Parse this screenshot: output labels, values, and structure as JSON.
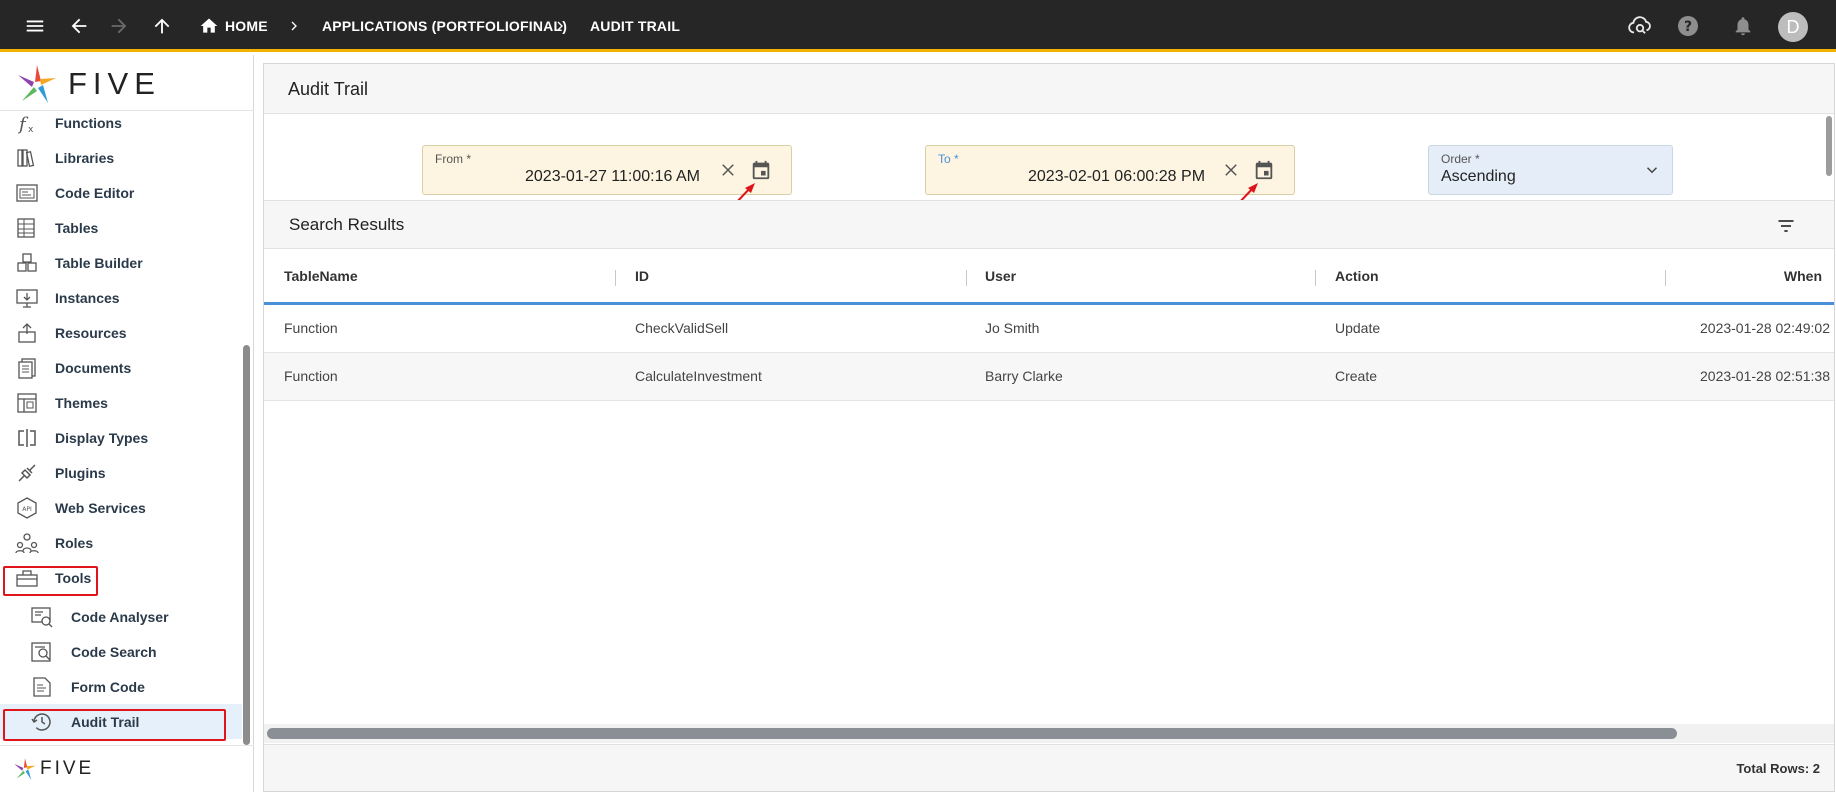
{
  "topbar": {
    "breadcrumbs": [
      "HOME",
      "APPLICATIONS (PORTFOLIOFINAL)",
      "AUDIT TRAIL"
    ],
    "avatar_initial": "D"
  },
  "sidebar": {
    "brand": "FIVE",
    "items": [
      {
        "label": "Functions",
        "icon": "function-icon"
      },
      {
        "label": "Libraries",
        "icon": "libraries-icon"
      },
      {
        "label": "Code Editor",
        "icon": "code-editor-icon"
      },
      {
        "label": "Tables",
        "icon": "tables-icon"
      },
      {
        "label": "Table Builder",
        "icon": "table-builder-icon"
      },
      {
        "label": "Instances",
        "icon": "instances-icon"
      },
      {
        "label": "Resources",
        "icon": "resources-icon"
      },
      {
        "label": "Documents",
        "icon": "documents-icon"
      },
      {
        "label": "Themes",
        "icon": "themes-icon"
      },
      {
        "label": "Display Types",
        "icon": "display-types-icon"
      },
      {
        "label": "Plugins",
        "icon": "plugins-icon"
      },
      {
        "label": "Web Services",
        "icon": "web-services-icon"
      },
      {
        "label": "Roles",
        "icon": "roles-icon"
      },
      {
        "label": "Tools",
        "icon": "tools-icon"
      }
    ],
    "sub_items": [
      {
        "label": "Code Analyser",
        "icon": "code-analyser-icon"
      },
      {
        "label": "Code Search",
        "icon": "code-search-icon"
      },
      {
        "label": "Form Code",
        "icon": "form-code-icon"
      },
      {
        "label": "Audit Trail",
        "icon": "history-icon"
      }
    ],
    "footer_brand": "FIVE"
  },
  "main": {
    "title": "Audit Trail",
    "from": {
      "label": "From *",
      "value": "2023-01-27 11:00:16 AM"
    },
    "to": {
      "label": "To *",
      "value": "2023-02-01 06:00:28 PM"
    },
    "order": {
      "label": "Order *",
      "value": "Ascending"
    },
    "results_title": "Search Results",
    "columns": [
      "TableName",
      "ID",
      "User",
      "Action",
      "When"
    ],
    "rows": [
      [
        "Function",
        "CheckValidSell",
        "Jo Smith",
        "Update",
        "2023-01-28 02:49:02"
      ],
      [
        "Function",
        "CalculateInvestment",
        "Barry Clarke",
        "Create",
        "2023-01-28 02:51:38"
      ]
    ],
    "total_rows": "Total Rows: 2"
  },
  "colors": {
    "topbar": "#262626",
    "accent": "#f3b200",
    "highlight": "#e0151b",
    "header_line": "#4a90d9"
  }
}
